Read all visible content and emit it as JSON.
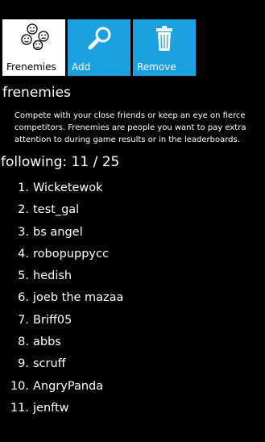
{
  "toolbar": {
    "frenemies_label": "Frenemies",
    "add_label": "Add",
    "remove_label": "Remove",
    "accent_color": "#1ba1e2"
  },
  "section": {
    "title": "frenemies",
    "description": "Compete with your close friends or keep an eye on fierce competitors. Frenemies are people you want to pay extra attention to during game results or in the leaderboards."
  },
  "following": {
    "text": "following: 11 / 25"
  },
  "list": [
    {
      "num": "1.",
      "name": "Wicketewok"
    },
    {
      "num": "2.",
      "name": "test_gal"
    },
    {
      "num": "3.",
      "name": "bs angel"
    },
    {
      "num": "4.",
      "name": "robopuppycc"
    },
    {
      "num": "5.",
      "name": "hedish"
    },
    {
      "num": "6.",
      "name": "joeb the mazaa"
    },
    {
      "num": "7.",
      "name": "Briff05"
    },
    {
      "num": "8.",
      "name": "abbs"
    },
    {
      "num": "9.",
      "name": "scruff"
    },
    {
      "num": "10.",
      "name": "AngryPanda"
    },
    {
      "num": "11.",
      "name": "jenftw"
    }
  ]
}
